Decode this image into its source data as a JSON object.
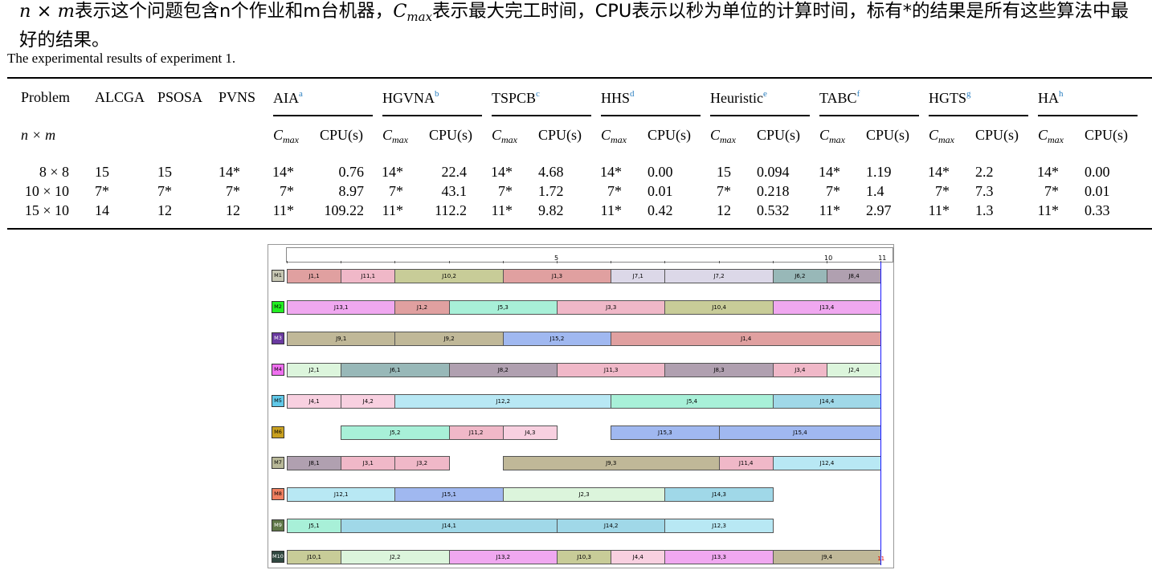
{
  "intro": {
    "var_n": "n",
    "times": "×",
    "var_m": "m",
    "part1": "表示这个问题包含n个作业和m台机器，",
    "cmax_c": "C",
    "cmax_sub": "max",
    "part2": "表示最大完工时间，CPU表示以秒为单位的计算时间，标有*的结果是所有这些算法中最好的结果。"
  },
  "caption": "The experimental results of experiment 1.",
  "table": {
    "headers": {
      "problem": "Problem",
      "alcga": "ALCGA",
      "psosa": "PSOSA",
      "pvns": "PVNS",
      "groups": [
        {
          "name": "AIA",
          "sup": "a"
        },
        {
          "name": "HGVNA",
          "sup": "b"
        },
        {
          "name": "TSPCB",
          "sup": "c"
        },
        {
          "name": "HHS",
          "sup": "d"
        },
        {
          "name": "Heuristic",
          "sup": "e"
        },
        {
          "name": "TABC",
          "sup": "f"
        },
        {
          "name": "HGTS",
          "sup": "g"
        },
        {
          "name": "HA",
          "sup": "h"
        }
      ],
      "sub_cmax_c": "C",
      "sub_cmax_sub": "max",
      "sub_cpu": "CPU(s)",
      "nxm": "n × m"
    },
    "rows": [
      [
        "8 × 8",
        "15",
        "15",
        "14*",
        "14*",
        "0.76",
        "14*",
        "22.4",
        "14*",
        "4.68",
        "14*",
        "0.00",
        "15",
        "0.094",
        "14*",
        "1.19",
        "14*",
        "2.2",
        "14*",
        "0.00"
      ],
      [
        "10 × 10",
        "7*",
        "7*",
        "7*",
        "7*",
        "8.97",
        "7*",
        "43.1",
        "7*",
        "1.72",
        "7*",
        "0.01",
        "7*",
        "0.218",
        "7*",
        "1.4",
        "7*",
        "7.3",
        "7*",
        "0.01"
      ],
      [
        "15 × 10",
        "14",
        "12",
        "12",
        "11*",
        "109.22",
        "11*",
        "112.2",
        "11*",
        "9.82",
        "11*",
        "0.42",
        "12",
        "0.532",
        "11*",
        "2.97",
        "11*",
        "1.3",
        "11*",
        "0.33"
      ]
    ]
  },
  "gantt": {
    "axis_ticks": [
      "5",
      "10",
      "11"
    ],
    "end_label": "11",
    "machines": [
      {
        "label": "M1",
        "color": "#c8c8b4",
        "ops": [
          [
            "J1,1",
            0,
            1,
            "#e0a0a0"
          ],
          [
            "J11,1",
            1,
            2,
            "#f0b8c8"
          ],
          [
            "J10,2",
            2,
            4,
            "#c8cc98"
          ],
          [
            "J1,3",
            4,
            6,
            "#e0a0a0"
          ],
          [
            "J7,1",
            6,
            7,
            "#dcd8e8"
          ],
          [
            "J7,2",
            7,
            9,
            "#dcd8e8"
          ],
          [
            "J6,2",
            9,
            10,
            "#98b8b8"
          ],
          [
            "J8,4",
            10,
            11,
            "#b0a0b0"
          ]
        ]
      },
      {
        "label": "M2",
        "color": "#22ee22",
        "ops": [
          [
            "J13,1",
            0,
            2,
            "#f0a8f0"
          ],
          [
            "J1,2",
            2,
            3,
            "#e0a0a0"
          ],
          [
            "J5,3",
            3,
            5,
            "#a8f0d8"
          ],
          [
            "J3,3",
            5,
            7,
            "#f0b8c8"
          ],
          [
            "J10,4",
            7,
            9,
            "#c8cc98"
          ],
          [
            "J13,4",
            9,
            11,
            "#f0a8f0"
          ]
        ]
      },
      {
        "label": "M3",
        "color": "#6a3aa0",
        "ops": [
          [
            "J9,1",
            0,
            2,
            "#c0b898"
          ],
          [
            "J9,2",
            2,
            4,
            "#c0b898"
          ],
          [
            "J15,2",
            4,
            6,
            "#a0b8f0"
          ],
          [
            "J1,4",
            6,
            11,
            "#e0a0a0"
          ]
        ]
      },
      {
        "label": "M4",
        "color": "#f070f0",
        "ops": [
          [
            "J2,1",
            0,
            1,
            "#dcf5dc"
          ],
          [
            "J6,1",
            1,
            3,
            "#98b8b8"
          ],
          [
            "J8,2",
            3,
            5,
            "#b0a0b0"
          ],
          [
            "J11,3",
            5,
            7,
            "#f0b8c8"
          ],
          [
            "J8,3",
            7,
            9,
            "#b0a0b0"
          ],
          [
            "J3,4",
            9,
            10,
            "#f0b8c8"
          ],
          [
            "J2,4",
            10,
            11,
            "#dcf5dc"
          ]
        ]
      },
      {
        "label": "M5",
        "color": "#60c8e8",
        "ops": [
          [
            "J4,1",
            0,
            1,
            "#f8d0e0"
          ],
          [
            "J4,2",
            1,
            2,
            "#f8d0e0"
          ],
          [
            "J12,2",
            2,
            6,
            "#b8e8f4"
          ],
          [
            "J5,4",
            6,
            9,
            "#a8f0d8"
          ],
          [
            "J14,4",
            9,
            11,
            "#a0d8e8"
          ]
        ]
      },
      {
        "label": "M6",
        "color": "#c8a020",
        "ops": [
          [
            "J5,2",
            1,
            3,
            "#a8f0d8"
          ],
          [
            "J11,2",
            3,
            4,
            "#f0b8c8"
          ],
          [
            "J4,3",
            4,
            5,
            "#f8d0e0"
          ],
          [
            "J15,3",
            6,
            8,
            "#a0b8f0"
          ],
          [
            "J15,4",
            8,
            11,
            "#a0b8f0"
          ]
        ]
      },
      {
        "label": "M7",
        "color": "#b8b898",
        "ops": [
          [
            "J8,1",
            0,
            1,
            "#b0a0b0"
          ],
          [
            "J3,1",
            1,
            2,
            "#f0b8c8"
          ],
          [
            "J3,2",
            2,
            3,
            "#f0b8c8"
          ],
          [
            "J9,3",
            4,
            8,
            "#c0b898"
          ],
          [
            "J11,4",
            8,
            9,
            "#f0b8c8"
          ],
          [
            "J12,4",
            9,
            11,
            "#b8e8f4"
          ]
        ]
      },
      {
        "label": "M8",
        "color": "#f08060",
        "ops": [
          [
            "J12,1",
            0,
            2,
            "#b8e8f4"
          ],
          [
            "J15,1",
            2,
            4,
            "#a0b8f0"
          ],
          [
            "J2,3",
            4,
            7,
            "#dcf5dc"
          ],
          [
            "J14,3",
            7,
            9,
            "#a0d8e8"
          ]
        ]
      },
      {
        "label": "M9",
        "color": "#607848",
        "ops": [
          [
            "J5,1",
            0,
            1,
            "#a8f0d8"
          ],
          [
            "J14,1",
            1,
            5,
            "#a0d8e8"
          ],
          [
            "J14,2",
            5,
            7,
            "#a0d8e8"
          ],
          [
            "J12,3",
            7,
            9,
            "#b8e8f4"
          ]
        ]
      },
      {
        "label": "M10",
        "color": "#304840",
        "ops": [
          [
            "J10,1",
            0,
            1,
            "#c8cc98"
          ],
          [
            "J2,2",
            1,
            3,
            "#dcf5dc"
          ],
          [
            "J13,2",
            3,
            5,
            "#f0a8f0"
          ],
          [
            "J10,3",
            5,
            6,
            "#c8cc98"
          ],
          [
            "J4,4",
            6,
            7,
            "#f8d0e0"
          ],
          [
            "J13,3",
            7,
            9,
            "#f0a8f0"
          ],
          [
            "J9,4",
            9,
            11,
            "#c0b898"
          ]
        ]
      }
    ]
  }
}
